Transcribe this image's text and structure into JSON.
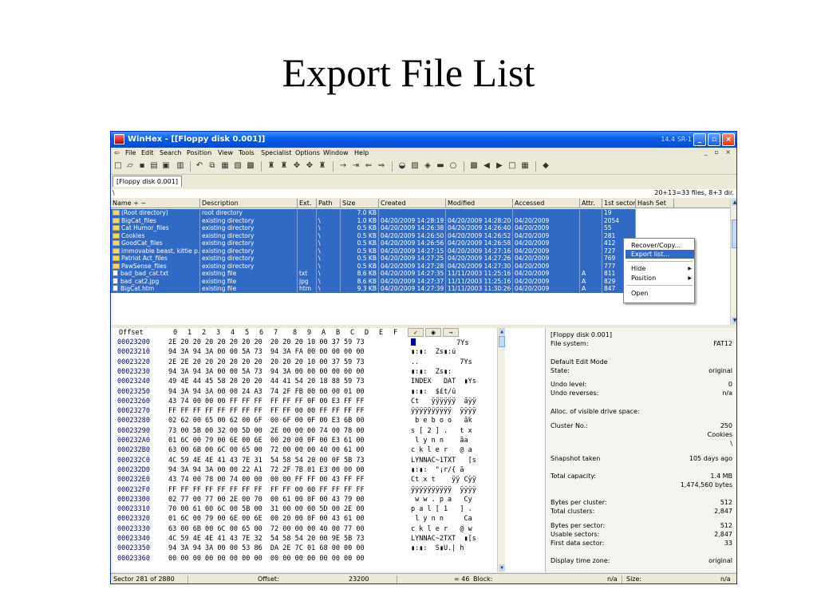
{
  "slide": {
    "title": "Export File List"
  },
  "window": {
    "title": "WinHex - [[Floppy disk 0.001]]",
    "version": "14.4 SR-1",
    "buttons": {
      "minimize": "_",
      "maximize": "▫",
      "close": "×"
    }
  },
  "menu": [
    "File",
    "Edit",
    "Search",
    "Position",
    "View",
    "Tools",
    "Specialist",
    "Options",
    "Window",
    "Help"
  ],
  "mdi_controls": "_ ▫ ×",
  "toolbar": {
    "icons": [
      "new-doc-icon",
      "open-folder-icon",
      "save-icon",
      "print-icon",
      "properties-icon",
      "open-disk-icon",
      "undo-icon",
      "copy-icon",
      "paste-icon",
      "clipboard-icon",
      "binary-icon",
      "find-icon",
      "find-hex-icon",
      "replace-icon",
      "replace-hex-icon",
      "find-binoculars-icon",
      "goto-offset-icon",
      "goto-sector-icon",
      "back-icon",
      "forward-icon",
      "disk-editor-icon",
      "ram-editor-icon",
      "hash-icon",
      "calculator-icon",
      "search-icon",
      "snapshot-icon",
      "prev-icon",
      "next-icon",
      "calendar-icon",
      "table-icon",
      "diamond-icon"
    ]
  },
  "doc_tab": "[Floppy disk 0.001]",
  "path": {
    "current": "\\",
    "summary": "20+13=33 files, 8+3 dir."
  },
  "columns": [
    "Name ÷ ~",
    "Description",
    "Ext.",
    "Path",
    "Size",
    "Created",
    "Modified",
    "Accessed",
    "Attr.",
    "1st sector",
    "Hash Set"
  ],
  "files": [
    {
      "name": "(Root directory)",
      "desc": "root directory",
      "ext": "",
      "path": "",
      "size": "7.0 KB",
      "created": "",
      "modified": "",
      "accessed": "",
      "attr": "",
      "sector": "19",
      "icon": "folder"
    },
    {
      "name": "BigCat_files",
      "desc": "existing directory",
      "ext": "",
      "path": "\\",
      "size": "1.0 KB",
      "created": "04/20/2009  14:28:19",
      "modified": "04/20/2009  14:28:20",
      "accessed": "04/20/2009",
      "attr": "",
      "sector": "2054",
      "icon": "folder"
    },
    {
      "name": "Cat Humor_files",
      "desc": "existing directory",
      "ext": "",
      "path": "\\",
      "size": "0.5 KB",
      "created": "04/20/2009  14:26:38",
      "modified": "04/20/2009  14:26:40",
      "accessed": "04/20/2009",
      "attr": "",
      "sector": "55",
      "icon": "folder"
    },
    {
      "name": "Cookies",
      "desc": "existing directory",
      "ext": "",
      "path": "\\",
      "size": "0.5 KB",
      "created": "04/20/2009  14:26:50",
      "modified": "04/20/2009  14:26:52",
      "accessed": "04/20/2009",
      "attr": "",
      "sector": "281",
      "icon": "folder"
    },
    {
      "name": "GoodCat_files",
      "desc": "existing directory",
      "ext": "",
      "path": "\\",
      "size": "0.5 KB",
      "created": "04/20/2009  14:26:56",
      "modified": "04/20/2009  14:26:58",
      "accessed": "04/20/2009",
      "attr": "",
      "sector": "412",
      "icon": "folder"
    },
    {
      "name": "immovable beast, kittie p...",
      "desc": "existing directory",
      "ext": "",
      "path": "\\",
      "size": "0.5 KB",
      "created": "04/20/2009  14:27:15",
      "modified": "04/20/2009  14:27:16",
      "accessed": "04/20/2009",
      "attr": "",
      "sector": "727",
      "icon": "folder"
    },
    {
      "name": "Patriot Act_files",
      "desc": "existing directory",
      "ext": "",
      "path": "\\",
      "size": "0.5 KB",
      "created": "04/20/2009  14:27:25",
      "modified": "04/20/2009  14:27:26",
      "accessed": "04/20/2009",
      "attr": "",
      "sector": "769",
      "icon": "folder"
    },
    {
      "name": "PawSense_files",
      "desc": "existing directory",
      "ext": "",
      "path": "\\",
      "size": "0.5 KB",
      "created": "04/20/2009  14:27:28",
      "modified": "04/20/2009  14:27:30",
      "accessed": "04/20/2009",
      "attr": "",
      "sector": "777",
      "icon": "folder"
    },
    {
      "name": "bad_bad_cat.txt",
      "desc": "existing file",
      "ext": "txt",
      "path": "\\",
      "size": "8.6 KB",
      "created": "04/20/2009  14:27:35",
      "modified": "11/11/2003  11:25:16",
      "accessed": "04/20/2009",
      "attr": "A",
      "sector": "811",
      "icon": "file"
    },
    {
      "name": "bad_cat2.jpg",
      "desc": "existing file",
      "ext": "jpg",
      "path": "\\",
      "size": "8.6 KB",
      "created": "04/20/2009  14:27:37",
      "modified": "11/11/2003  11:25:16",
      "accessed": "04/20/2009",
      "attr": "A",
      "sector": "829",
      "icon": "file"
    },
    {
      "name": "BigCat.htm",
      "desc": "existing file",
      "ext": "htm",
      "path": "\\",
      "size": "9.3 KB",
      "created": "04/20/2009  14:27:39",
      "modified": "11/11/2003  11:30:26",
      "accessed": "04/20/2009",
      "attr": "A",
      "sector": "847",
      "icon": "file"
    }
  ],
  "context_menu": {
    "items": [
      "Recover/Copy...",
      "Export list...",
      "Hide",
      "Position",
      "Open"
    ],
    "highlighted": "Export list...",
    "submenu_arrow": "▶"
  },
  "hex": {
    "header_offset": "Offset",
    "header_cols": [
      "0",
      "1",
      "2",
      "3",
      "4",
      "5",
      "6",
      "7",
      "8",
      "9",
      "A",
      "B",
      "C",
      "D",
      "E",
      "F"
    ],
    "rows": [
      {
        "off": "00023200",
        "bytes": "2E 20 20 20 20 20 20 20  20 20 20 10 00 37 59 73",
        "ascii": "          7Ys"
      },
      {
        "off": "00023210",
        "bytes": "94 3A 94 3A 00 00 5A 73  94 3A FA 00 00 00 00 00",
        "ascii": "▮:▮:  Zs▮:ú"
      },
      {
        "off": "00023220",
        "bytes": "2E 2E 20 20 20 20 20 20  20 20 20 10 00 37 59 73",
        "ascii": "..          7Ys"
      },
      {
        "off": "00023230",
        "bytes": "94 3A 94 3A 00 00 5A 73  94 3A 00 00 00 00 00 00",
        "ascii": "▮:▮:  Zs▮:"
      },
      {
        "off": "00023240",
        "bytes": "49 4E 44 45 58 20 20 20  44 41 54 20 18 88 59 73",
        "ascii": "INDEX   DAT  ▮Ys"
      },
      {
        "off": "00023250",
        "bytes": "94 3A 94 3A 00 00 24 A3  74 2F FB 00 00 00 01 00",
        "ascii": "▮:▮:  $£t/û"
      },
      {
        "off": "00023260",
        "bytes": "43 74 00 00 00 FF FF FF  FF FF FF 0F 00 E3 FF FF",
        "ascii": "Ct   ÿÿÿÿÿÿ  ãÿÿ"
      },
      {
        "off": "00023270",
        "bytes": "FF FF FF FF FF FF FF FF  FF FF 00 00 FF FF FF FF",
        "ascii": "ÿÿÿÿÿÿÿÿÿÿ  ÿÿÿÿ"
      },
      {
        "off": "00023280",
        "bytes": "02 62 00 65 00 62 00 6F  00 6F 00 0F 00 E3 6B 00",
        "ascii": " b e b o o   ãk"
      },
      {
        "off": "00023290",
        "bytes": "73 00 5B 00 32 00 5D 00  2E 00 00 00 74 00 78 00",
        "ascii": "s [ 2 ] .   t x"
      },
      {
        "off": "000232A0",
        "bytes": "01 6C 00 79 00 6E 00 6E  00 20 00 0F 00 E3 61 00",
        "ascii": " l y n n    ãa"
      },
      {
        "off": "000232B0",
        "bytes": "63 00 6B 00 6C 00 65 00  72 00 00 00 40 00 61 00",
        "ascii": "c k l e r   @ a"
      },
      {
        "off": "000232C0",
        "bytes": "4C 59 4E 4E 41 43 7E 31  54 58 54 20 00 0F 5B 73",
        "ascii": "LYNNAC~1TXT   [s"
      },
      {
        "off": "000232D0",
        "bytes": "94 3A 94 3A 00 00 22 A1  72 2F 7B 01 E3 00 00 00",
        "ascii": "▮:▮:  \"¡r/{ ã"
      },
      {
        "off": "000232E0",
        "bytes": "43 74 00 78 00 74 00 00  00 00 FF FF 00 43 FF FF",
        "ascii": "Ct x t    ÿÿ Cÿÿ"
      },
      {
        "off": "000232F0",
        "bytes": "FF FF FF FF FF FF FF FF  FF FF 00 00 FF FF FF FF",
        "ascii": "ÿÿÿÿÿÿÿÿÿÿ  ÿÿÿÿ"
      },
      {
        "off": "00023300",
        "bytes": "02 77 00 77 00 2E 00 70  00 61 00 0F 00 43 79 00",
        "ascii": " w w . p a   Cy"
      },
      {
        "off": "00023310",
        "bytes": "70 00 61 00 6C 00 5B 00  31 00 00 00 5D 00 2E 00",
        "ascii": "p a l [ 1   ] ."
      },
      {
        "off": "00023320",
        "bytes": "01 6C 00 79 00 6E 00 6E  00 20 00 0F 00 43 61 00",
        "ascii": " l y n n     Ca"
      },
      {
        "off": "00023330",
        "bytes": "63 00 6B 00 6C 00 65 00  72 00 00 00 40 00 77 00",
        "ascii": "c k l e r   @ w"
      },
      {
        "off": "00023340",
        "bytes": "4C 59 4E 4E 41 43 7E 32  54 58 54 20 00 9E 5B 73",
        "ascii": "LYNNAC~2TXT  ▮[s"
      },
      {
        "off": "00023350",
        "bytes": "94 3A 94 3A 00 00 53 86  DA 2E 7C 01 68 00 00 00",
        "ascii": "▮:▮:  S▮Ú.| h"
      },
      {
        "off": "00023360",
        "bytes": "00 00 00 00 00 00 00 00  00 00 00 00 00 00 00 00",
        "ascii": ""
      }
    ]
  },
  "info": [
    {
      "label": "[Floppy disk 0.001]",
      "value": ""
    },
    {
      "label": "File system:",
      "value": "FAT12"
    },
    {
      "label": "Default Edit Mode",
      "value": ""
    },
    {
      "label": "State:",
      "value": "original"
    },
    {
      "label": "Undo level:",
      "value": "0"
    },
    {
      "label": "Undo reverses:",
      "value": "n/a"
    },
    {
      "label": "Alloc. of visible drive space:",
      "value": ""
    },
    {
      "label": "Cluster No.:",
      "value": "250"
    },
    {
      "label": "",
      "value": "Cookies"
    },
    {
      "label": "",
      "value": "\\"
    },
    {
      "label": "Snapshot taken",
      "value": "105 days ago"
    },
    {
      "label": "Total capacity:",
      "value": "1.4 MB"
    },
    {
      "label": "",
      "value": "1,474,560 bytes"
    },
    {
      "label": "Bytes per cluster:",
      "value": "512"
    },
    {
      "label": "Total clusters:",
      "value": "2,847"
    },
    {
      "label": "Bytes per sector:",
      "value": "512"
    },
    {
      "label": "Usable sectors:",
      "value": "2,847"
    },
    {
      "label": "First data sector:",
      "value": "33"
    },
    {
      "label": "Display time zone:",
      "value": "original"
    }
  ],
  "status": {
    "sector": "Sector 281 of 2880",
    "offset_label": "Offset:",
    "offset_value": "23200",
    "eq_value": "= 46",
    "block_label": "Block:",
    "block_value": "n/a",
    "size_label": "Size:",
    "size_value": "n/a"
  },
  "colors": {
    "selection": "#316ac5",
    "title_bar": "#0a5fe8",
    "offset_text": "#00008b"
  }
}
